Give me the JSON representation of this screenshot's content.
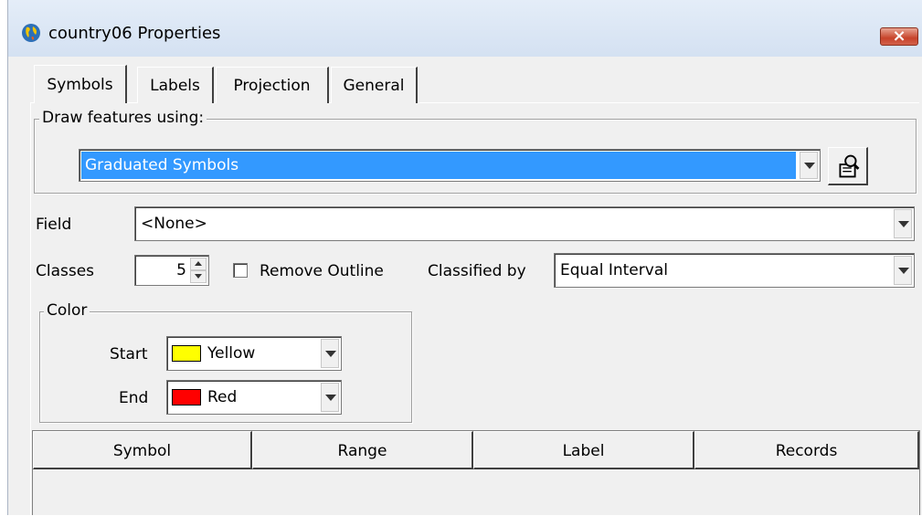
{
  "window": {
    "title": "country06 Properties",
    "close_symbol": "×"
  },
  "tabs": [
    {
      "label": "Symbols",
      "active": true
    },
    {
      "label": "Labels"
    },
    {
      "label": "Projection"
    },
    {
      "label": "General"
    }
  ],
  "draw_group": {
    "label": "Draw features using:",
    "selected": "Graduated Symbols"
  },
  "field": {
    "label": "Field",
    "value": "<None>"
  },
  "classes": {
    "label": "Classes",
    "value": "5",
    "remove_outline_label": "Remove Outline",
    "remove_outline_checked": false,
    "classified_by_label": "Classified by",
    "classified_by_value": "Equal Interval"
  },
  "color_group": {
    "label": "Color",
    "start_label": "Start",
    "start_value": "Yellow",
    "start_color": "#ffff00",
    "end_label": "End",
    "end_value": "Red",
    "end_color": "#ff0000"
  },
  "table": {
    "headers": [
      "Symbol",
      "Range",
      "Label",
      "Records"
    ]
  },
  "icons": {
    "app": "globe-icon",
    "tool": "zoom-to-layer-icon",
    "close": "close-icon"
  }
}
